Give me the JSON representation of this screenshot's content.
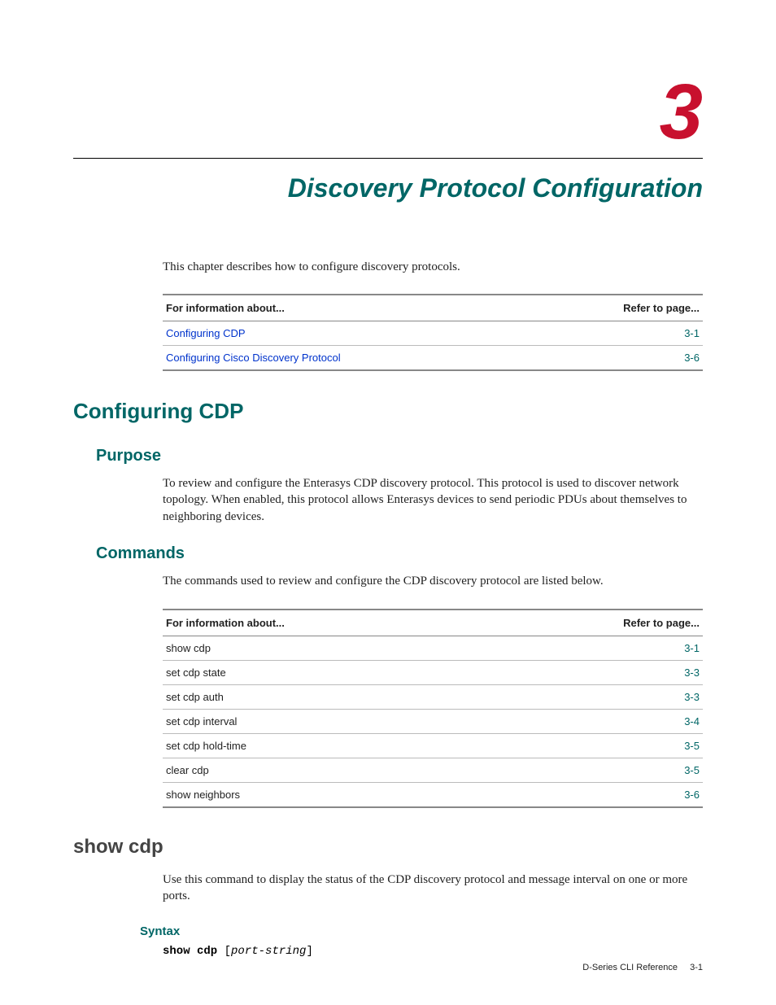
{
  "chapter": {
    "number": "3",
    "title": "Discovery Protocol Configuration",
    "intro": "This chapter describes how to configure discovery protocols."
  },
  "toc_table": {
    "headers": [
      "For information about...",
      "Refer to page..."
    ],
    "rows": [
      {
        "label": "Configuring CDP",
        "page": "3-1"
      },
      {
        "label": "Configuring Cisco Discovery Protocol",
        "page": "3-6"
      }
    ]
  },
  "section_configuring": {
    "title": "Configuring CDP",
    "purpose": {
      "heading": "Purpose",
      "text": "To review and configure the Enterasys CDP discovery protocol. This protocol is used to discover network topology. When enabled, this protocol allows Enterasys devices to send periodic PDUs about themselves to neighboring devices."
    },
    "commands": {
      "heading": "Commands",
      "intro": "The commands used to review and configure the CDP discovery protocol are listed below.",
      "headers": [
        "For information about...",
        "Refer to page..."
      ],
      "rows": [
        {
          "label": "show cdp",
          "page": "3-1"
        },
        {
          "label": "set cdp state",
          "page": "3-3"
        },
        {
          "label": "set cdp auth",
          "page": "3-3"
        },
        {
          "label": "set cdp interval",
          "page": "3-4"
        },
        {
          "label": "set cdp hold-time",
          "page": "3-5"
        },
        {
          "label": "clear cdp",
          "page": "3-5"
        },
        {
          "label": "show neighbors",
          "page": "3-6"
        }
      ]
    }
  },
  "section_showcdp": {
    "title": "show cdp",
    "text": "Use this command to display the status of the CDP discovery protocol and message interval on one or more ports.",
    "syntax": {
      "heading": "Syntax",
      "cmd": "show cdp",
      "open": " [",
      "param": "port-string",
      "close": "]"
    }
  },
  "footer": {
    "doc": "D-Series CLI Reference",
    "page": "3-1"
  }
}
